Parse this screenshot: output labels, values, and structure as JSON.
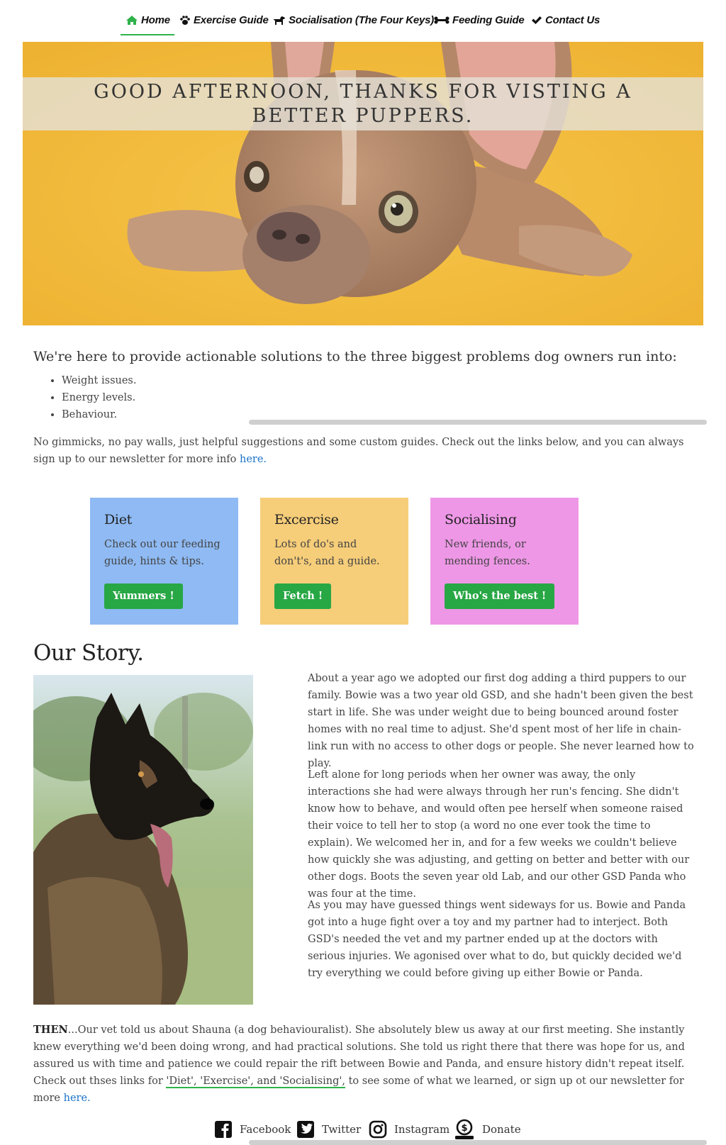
{
  "nav": {
    "items": [
      {
        "label": "Home",
        "icon": "home-icon"
      },
      {
        "label": "Exercise Guide",
        "icon": "paw-icon"
      },
      {
        "label": "Socialisation (The Four Keys)",
        "icon": "dog-icon"
      },
      {
        "label": "Feeding Guide",
        "icon": "bone-icon"
      },
      {
        "label": "Contact Us",
        "icon": "checkmark-icon"
      }
    ],
    "active": "Home",
    "accent_color": "#2fb24a"
  },
  "hero": {
    "greeting": "Good afternoon, thanks for visting A Better Puppers."
  },
  "intro": {
    "title": "We're here to provide actionable solutions to the three biggest problems dog owners run into:",
    "problems": [
      "Weight issues.",
      "Energy levels.",
      "Behaviour."
    ],
    "body": "No gimmicks, no pay walls, just helpful suggestions and some custom guides. Check out the links below, and you can always sign up to our newsletter for more info",
    "link_text": "here."
  },
  "cards": [
    {
      "title": "Diet",
      "text": "Check out our feeding guide, hints & tips.",
      "button": "Yummers !",
      "color": "#8fbaf3"
    },
    {
      "title": "Excercise",
      "text": "Lots of do's and don't's, and a guide.",
      "button": "Fetch !",
      "color": "#f6cd79"
    },
    {
      "title": "Socialising",
      "text": "New friends, or mending fences.",
      "button": "Who's the best !",
      "color": "#ee97e6"
    }
  ],
  "story": {
    "title": "Our Story.",
    "paragraphs": [
      "About a year ago we adopted our first dog adding a third puppers to our family. Bowie was a two year old GSD, and she hadn't been given the best start in life. She was under weight due to being bounced around foster homes with no real time to adjust. She'd spent most of her life in chain-link run with no access to other dogs or people. She never learned how to play.",
      "Left alone for long periods when her owner was away, the only interactions she had were always through her run's fencing. She didn't know how to behave, and would often pee herself when someone raised their voice to tell her to stop (a word no one ever took the time to explain). We welcomed her in, and for a few weeks we couldn't believe how quickly she was adjusting, and getting on better and better with our other dogs. Boots the seven year old Lab, and our other GSD Panda who was four at the time.",
      "As you may have guessed things went sideways for us. Bowie and Panda got into a huge fight over a toy and my partner had to interject. Both GSD's needed the vet and my partner ended up at the doctors with serious injuries. We agonised over what to do, but quickly decided we'd try everything we could before giving up either Bowie or Panda."
    ],
    "then_lead": "THEN",
    "then_body_1": "...Our vet told us about Shauna (a dog behaviouralist). She absolutely blew us away at our first meeting. She instantly knew everything we'd been doing wrong, and had practical solutions. She told us right there that there was hope for us, and assured us with time and patience we could repair the rift between Bowie and Panda, and ensure history didn't repeat itself. Check out thses links for",
    "then_links": "'Diet', 'Exercise', and 'Socialising',",
    "then_body_2": "to see some of what we learned, or sign up ot our newsletter for more",
    "then_link": "here."
  },
  "footer": {
    "items": [
      {
        "label": "Facebook",
        "icon": "facebook-icon"
      },
      {
        "label": "Twitter",
        "icon": "twitter-icon"
      },
      {
        "label": "Instagram",
        "icon": "instagram-icon"
      },
      {
        "label": "Donate",
        "icon": "donate-icon"
      }
    ]
  },
  "colors": {
    "button_green": "#28a745",
    "link_blue": "#1a73c9",
    "hero_yellow": "#f2bb3a"
  }
}
